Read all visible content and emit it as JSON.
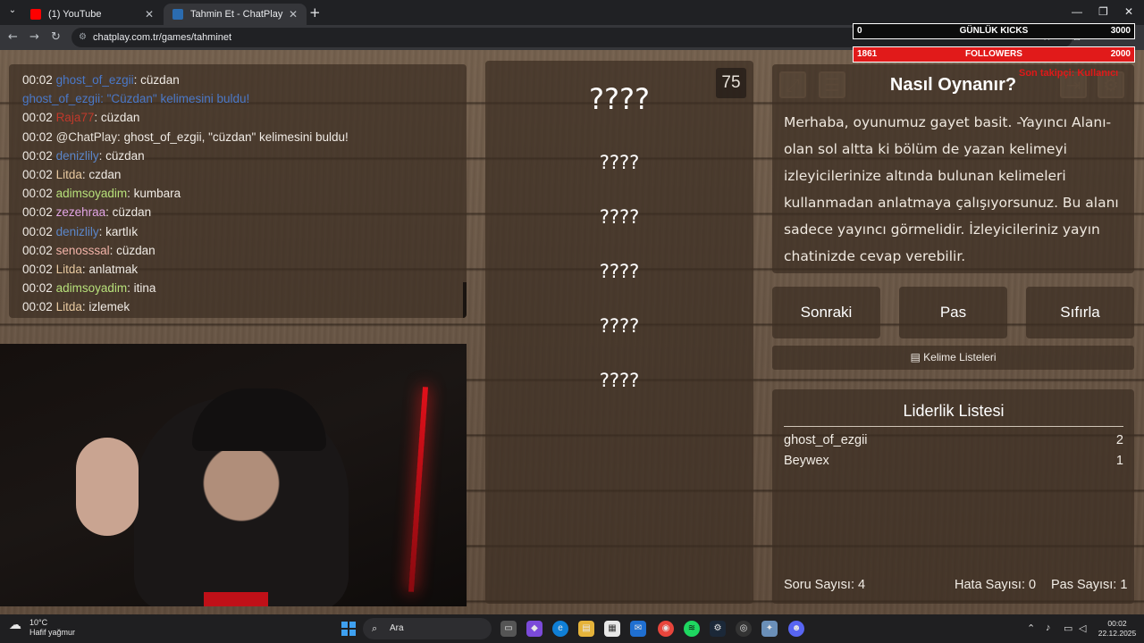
{
  "browser": {
    "tabs": [
      {
        "title": "(1) YouTube",
        "active": false,
        "favicon_color": "#ff0000"
      },
      {
        "title": "Tahmin Et - ChatPlay",
        "active": true,
        "favicon_color": "#2b6cb0"
      }
    ],
    "url": "chatplay.com.tr/games/tahminet"
  },
  "chat": {
    "lines": [
      {
        "time": "00:02",
        "user": "ghost_of_ezgii",
        "sep": ":",
        "text": "cüzdan",
        "color": "#4a78c8"
      },
      {
        "time": "",
        "user": "ghost_of_ezgii:",
        "sep": " ",
        "text": "\"Cüzdan\" kelimesini buldu!",
        "color": "#4a78c8",
        "text_color": "#4a78c8"
      },
      {
        "time": "00:02",
        "user": "Raja77",
        "sep": ":",
        "text": "cüzdan",
        "color": "#c0392b"
      },
      {
        "time": "00:02",
        "user": "@ChatPlay",
        "sep": ":",
        "text": "ghost_of_ezgii, \"cüzdan\" kelimesini buldu!",
        "color": "#e8e2da"
      },
      {
        "time": "00:02",
        "user": "denizlily",
        "sep": ":",
        "text": "cüzdan",
        "color": "#5b86c9"
      },
      {
        "time": "00:02",
        "user": "Litda",
        "sep": ":",
        "text": "czdan",
        "color": "#e8c9a0"
      },
      {
        "time": "00:02",
        "user": "adimsoyadim",
        "sep": ":",
        "text": "kumbara",
        "color": "#b7e07a"
      },
      {
        "time": "00:02",
        "user": "zezehraa",
        "sep": ":",
        "text": "cüzdan",
        "color": "#e3a6e6"
      },
      {
        "time": "00:02",
        "user": "denizlily",
        "sep": ":",
        "text": "kartlık",
        "color": "#5b86c9"
      },
      {
        "time": "00:02",
        "user": "senosssal",
        "sep": ":",
        "text": "cüzdan",
        "color": "#f2b3a8"
      },
      {
        "time": "00:02",
        "user": "Litda",
        "sep": ":",
        "text": "anlatmak",
        "color": "#e8c9a0"
      },
      {
        "time": "00:02",
        "user": "adimsoyadim",
        "sep": ":",
        "text": "itina",
        "color": "#b7e07a"
      },
      {
        "time": "00:02",
        "user": "Litda",
        "sep": ":",
        "text": "izlemek",
        "color": "#e8c9a0"
      }
    ]
  },
  "words": [
    "????",
    "????",
    "????",
    "????",
    "????",
    "????"
  ],
  "timer": "75",
  "howto": {
    "title": "Nasıl Oynanır?",
    "text": "Merhaba, oyunumuz gayet basit. -Yayıncı Alanı- olan sol altta ki bölüm de yazan kelimeyi izleyicilerinize altında bulunan kelimeleri kullanmadan anlatmaya çalışıyorsunuz. Bu alanı sadece yayıncı görmelidir. İzleyicileriniz yayın chatinizde cevap verebilir."
  },
  "buttons": {
    "next": "Sonraki",
    "pass": "Pas",
    "reset": "Sıfırla",
    "word_lists": "Kelime Listeleri"
  },
  "leaderboard": {
    "title": "Liderlik Listesi",
    "rows": [
      {
        "name": "ghost_of_ezgii",
        "score": "2"
      },
      {
        "name": "Beywex",
        "score": "1"
      }
    ],
    "questions_label": "Soru Sayısı:",
    "questions": "4",
    "errors_label": "Hata Sayısı:",
    "errors": "0",
    "passes_label": "Pas Sayısı:",
    "passes": "1"
  },
  "overlay": {
    "kicks": {
      "current": "0",
      "label": "GÜNLÜK KICKS",
      "goal": "3000"
    },
    "followers": {
      "current": "1861",
      "label": "FOLLOWERS",
      "goal": "2000"
    },
    "red_text": "Son takipçi: Kullanıcı"
  },
  "taskbar": {
    "weather_temp": "10°C",
    "weather_desc": "Hafif yağmur",
    "search_placeholder": "Ara",
    "time": "00:02",
    "date": "22.12.2025"
  }
}
